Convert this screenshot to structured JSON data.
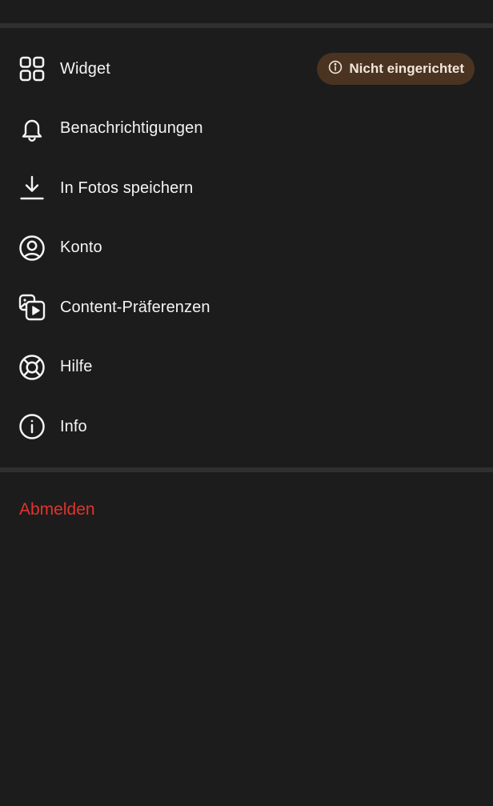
{
  "menu": {
    "items": [
      {
        "id": "widget",
        "label": "Widget",
        "icon": "widget-grid-icon"
      },
      {
        "id": "notifications",
        "label": "Benachrichtigungen",
        "icon": "bell-icon"
      },
      {
        "id": "save-photos",
        "label": "In Fotos speichern",
        "icon": "download-icon"
      },
      {
        "id": "account",
        "label": "Konto",
        "icon": "account-icon"
      },
      {
        "id": "content-preferences",
        "label": "Content-Präferenzen",
        "icon": "media-stack-icon"
      },
      {
        "id": "help",
        "label": "Hilfe",
        "icon": "lifebuoy-icon"
      },
      {
        "id": "info",
        "label": "Info",
        "icon": "info-icon"
      }
    ],
    "widget_badge": {
      "label": "Nicht eingerichtet",
      "icon": "info-small-icon"
    }
  },
  "logout": {
    "label": "Abmelden"
  },
  "colors": {
    "background": "#1c1c1c",
    "divider": "#2f2f31",
    "text": "#f4f4f4",
    "badge_background": "#4a3321",
    "badge_text": "#f1e6dc",
    "logout": "#e0342e"
  }
}
